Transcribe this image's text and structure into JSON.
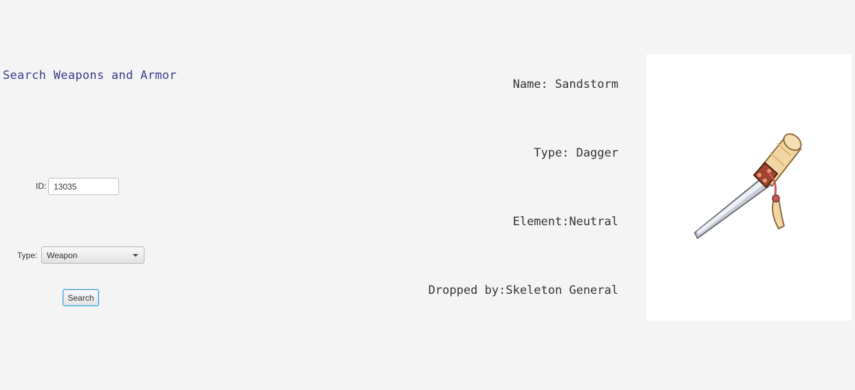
{
  "search_panel": {
    "title": "Search Weapons and Armor",
    "id_label": "ID:",
    "id_value": "13035",
    "type_label": "Type:",
    "type_selected": "Weapon",
    "search_button": "Search"
  },
  "details": {
    "name": "Name: Sandstorm",
    "type": "Type: Dagger",
    "element": "Element:Neutral",
    "dropped_by": "Dropped by:Skeleton General"
  },
  "item_image": {
    "icon": "dagger-icon",
    "colors": {
      "blade": "#c8ccd6",
      "handle": "#f1d6a3",
      "wrap": "#a0442e"
    }
  }
}
